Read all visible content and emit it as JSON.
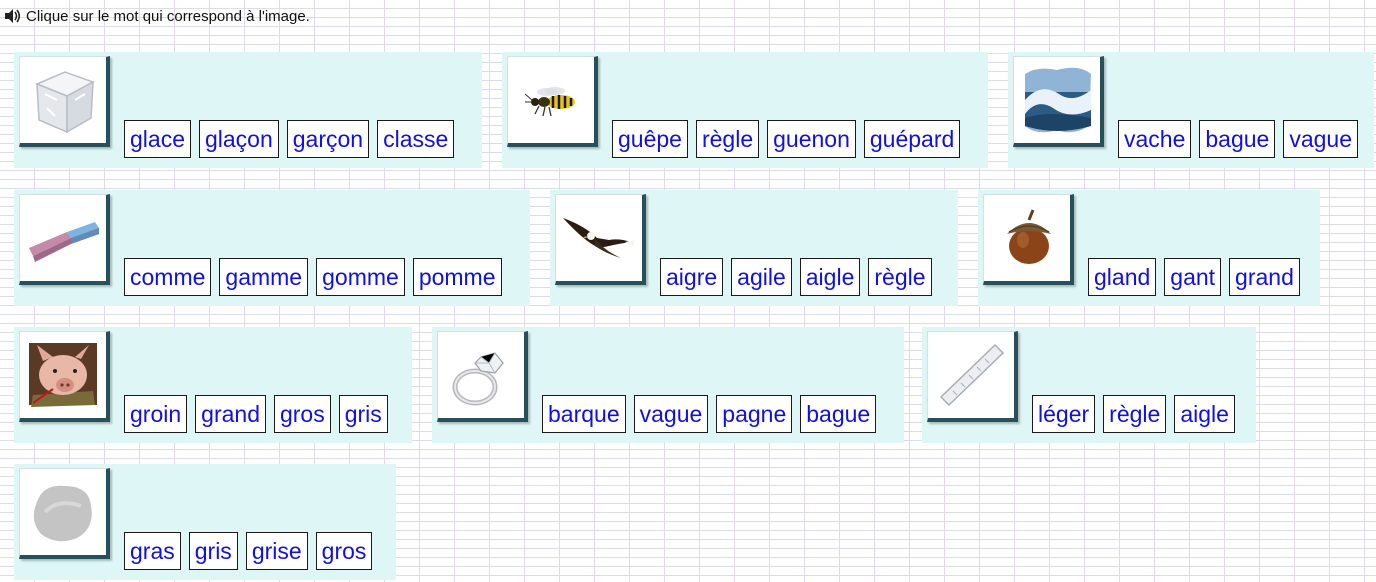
{
  "instruction": "Clique sur le mot qui correspond à l'image.",
  "icons": {
    "audio": "speaker-icon"
  },
  "colors": {
    "card_bg": "#dff6f6",
    "word_text": "#1010e0",
    "frame": "#27505a"
  },
  "cards": [
    {
      "image": "ice-cube",
      "words": [
        "glace",
        "glaçon",
        "garçon",
        "classe"
      ]
    },
    {
      "image": "wasp",
      "words": [
        "guêpe",
        "règle",
        "guenon",
        "guépard"
      ]
    },
    {
      "image": "wave",
      "words": [
        "vache",
        "bague",
        "vague"
      ]
    },
    {
      "image": "eraser",
      "words": [
        "comme",
        "gamme",
        "gomme",
        "pomme"
      ]
    },
    {
      "image": "eagle",
      "words": [
        "aigre",
        "agile",
        "aigle",
        "règle"
      ]
    },
    {
      "image": "acorn",
      "words": [
        "gland",
        "gant",
        "grand"
      ]
    },
    {
      "image": "pig",
      "words": [
        "groin",
        "grand",
        "gros",
        "gris"
      ]
    },
    {
      "image": "ring",
      "words": [
        "barque",
        "vague",
        "pagne",
        "bague"
      ]
    },
    {
      "image": "ruler",
      "words": [
        "léger",
        "règle",
        "aigle"
      ]
    },
    {
      "image": "grey-smudge",
      "words": [
        "gras",
        "gris",
        "grise",
        "gros"
      ]
    }
  ]
}
